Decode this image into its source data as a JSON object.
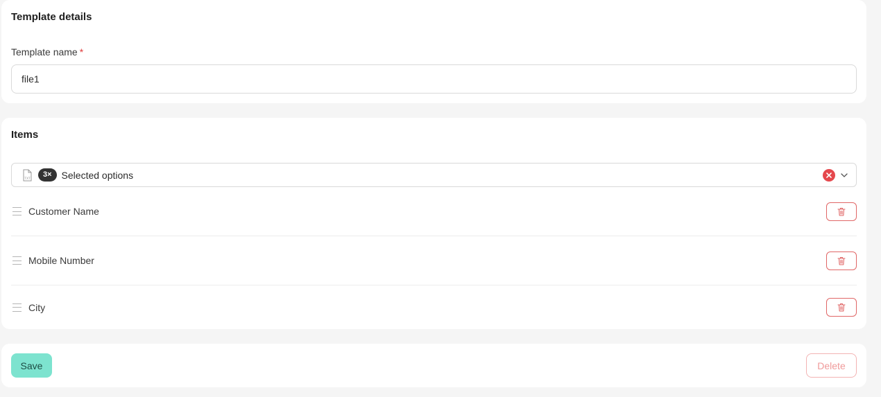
{
  "details": {
    "title": "Template details",
    "name_label": "Template name",
    "required_mark": "*",
    "name_value": "file1"
  },
  "items": {
    "title": "Items",
    "select": {
      "icon": "txt-file-icon",
      "count": "3×",
      "text": "Selected options"
    },
    "list": [
      {
        "label": "Customer Name"
      },
      {
        "label": "Mobile Number"
      },
      {
        "label": "City"
      }
    ]
  },
  "actions": {
    "save_label": "Save",
    "delete_label": "Delete"
  },
  "colors": {
    "save_bg": "#7de3cf",
    "danger": "#e5484d"
  }
}
